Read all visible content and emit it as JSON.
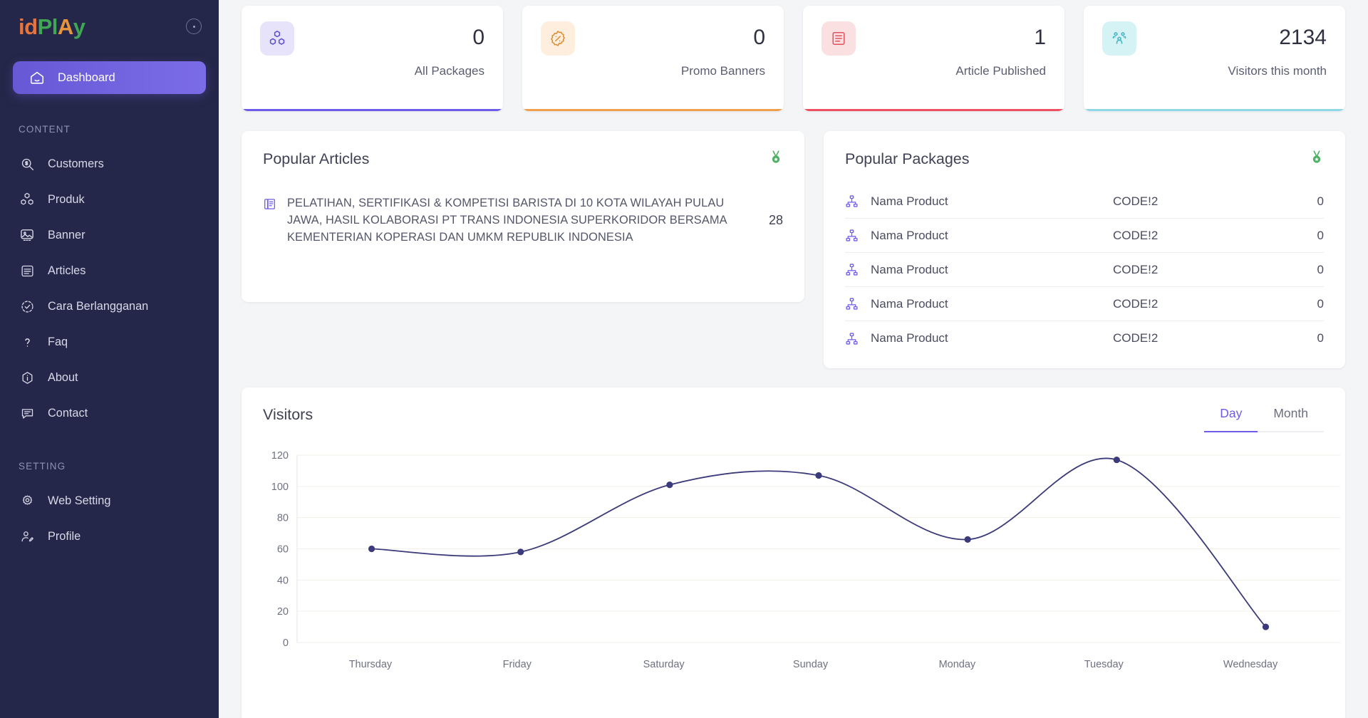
{
  "brand": {
    "logo_parts": [
      "id",
      "Pl",
      "A",
      "y"
    ],
    "colors": {
      "orange": "#e8743b",
      "green": "#3fa654",
      "accent": "#6c5ce7",
      "sidebar_bg": "#242749"
    }
  },
  "sidebar": {
    "active_item": {
      "label": "Dashboard",
      "icon": "home-icon"
    },
    "sections": [
      {
        "title": "CONTENT",
        "items": [
          {
            "label": "Customers",
            "icon": "search-dollar-icon"
          },
          {
            "label": "Produk",
            "icon": "boxes-icon"
          },
          {
            "label": "Banner",
            "icon": "image-icon"
          },
          {
            "label": "Articles",
            "icon": "article-icon"
          },
          {
            "label": "Cara Berlangganan",
            "icon": "check-circle-dashed-icon"
          },
          {
            "label": "Faq",
            "icon": "question-mark-icon"
          },
          {
            "label": "About",
            "icon": "info-hexagon-icon"
          },
          {
            "label": "Contact",
            "icon": "chat-icon"
          }
        ]
      },
      {
        "title": "SETTING",
        "items": [
          {
            "label": "Web Setting",
            "icon": "gear-icon"
          },
          {
            "label": "Profile",
            "icon": "user-edit-icon"
          }
        ]
      }
    ]
  },
  "stats": [
    {
      "value": "0",
      "label": "All Packages",
      "icon": "boxes-icon",
      "accent": "#6c5ce7"
    },
    {
      "value": "0",
      "label": "Promo Banners",
      "icon": "percent-badge-icon",
      "accent": "#f0a04b"
    },
    {
      "value": "1",
      "label": "Article Published",
      "icon": "document-icon",
      "accent": "#ef4f5f"
    },
    {
      "value": "2134",
      "label": "Visitors this month",
      "icon": "users-group-icon",
      "accent": "#8fd8e8"
    }
  ],
  "popular_articles": {
    "title": "Popular Articles",
    "badge_icon": "medal-icon",
    "items": [
      {
        "icon": "book-icon",
        "text": "PELATIHAN, SERTIFIKASI & KOMPETISI BARISTA DI 10 KOTA WILAYAH PULAU JAWA, HASIL KOLABORASI PT TRANS INDONESIA SUPERKORIDOR BERSAMA KEMENTERIAN KOPERASI DAN UMKM REPUBLIK INDONESIA",
        "count": "28"
      }
    ]
  },
  "popular_packages": {
    "title": "Popular Packages",
    "badge_icon": "medal-icon",
    "rows": [
      {
        "icon": "sitemap-icon",
        "name": "Nama Product",
        "code": "CODE!2",
        "value": "0"
      },
      {
        "icon": "sitemap-icon",
        "name": "Nama Product",
        "code": "CODE!2",
        "value": "0"
      },
      {
        "icon": "sitemap-icon",
        "name": "Nama Product",
        "code": "CODE!2",
        "value": "0"
      },
      {
        "icon": "sitemap-icon",
        "name": "Nama Product",
        "code": "CODE!2",
        "value": "0"
      },
      {
        "icon": "sitemap-icon",
        "name": "Nama Product",
        "code": "CODE!2",
        "value": "0"
      }
    ]
  },
  "visitors_panel": {
    "title": "Visitors",
    "tabs": [
      {
        "label": "Day",
        "active": true
      },
      {
        "label": "Month",
        "active": false
      }
    ]
  },
  "chart_data": {
    "type": "line",
    "title": "Visitors",
    "xlabel": "",
    "ylabel": "",
    "categories": [
      "Thursday",
      "Friday",
      "Saturday",
      "Sunday",
      "Monday",
      "Tuesday",
      "Wednesday"
    ],
    "series": [
      {
        "name": "Visitors",
        "values": [
          60,
          58,
          101,
          107,
          66,
          117,
          10
        ],
        "color": "#3b3a7a"
      }
    ],
    "ylim": [
      0,
      120
    ],
    "yticks": [
      0,
      20,
      40,
      60,
      80,
      100,
      120
    ],
    "grid": true,
    "legend": "none",
    "curve": "smooth",
    "markers": true
  }
}
